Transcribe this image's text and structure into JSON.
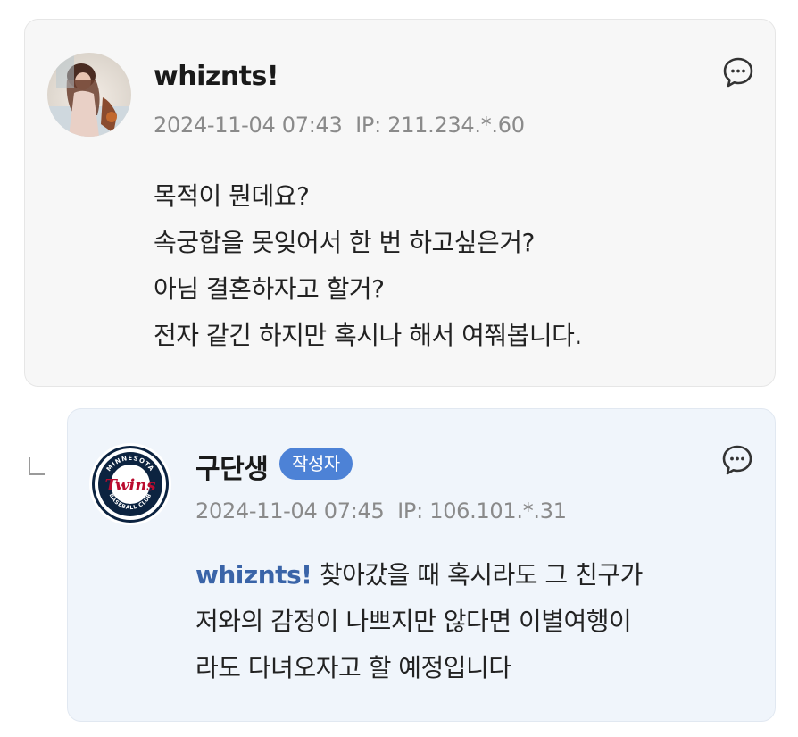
{
  "comments": [
    {
      "username": "whiznts!",
      "datetime": "2024-11-04 07:43",
      "ip": "IP: 211.234.*.60",
      "avatar_icon": "profile-photo",
      "reply_icon": "speech-bubble-icon",
      "lines": [
        "목적이 뭔데요?",
        "속궁합을 못잊어서 한 번 하고싶은거?",
        "아님 결혼하자고 할거?",
        "전자 같긴 하지만 혹시나 해서 여쭤봅니다."
      ]
    },
    {
      "username": "구단생",
      "badge": "작성자",
      "datetime": "2024-11-04 07:45",
      "ip": "IP: 106.101.*.31",
      "avatar_icon": "minnesota-twins-logo",
      "reply_icon": "speech-bubble-icon",
      "mention": "whiznts!",
      "lines": [
        "찾아갔을 때 혹시라도 그 친구가",
        "저와의 감정이 나쁘지만 않다면 이별여행이",
        "라도 다녀오자고 할 예정입니다"
      ],
      "logo_text": {
        "top": "MINNESOTA",
        "center": "Twins",
        "bottom": "BASEBALL CLUB"
      }
    }
  ],
  "colors": {
    "card_bg": "#f7f7f7",
    "reply_card_bg": "#f0f5fb",
    "badge_bg": "#4d82d6",
    "mention": "#3a64a8",
    "meta_text": "#8a8a8a"
  }
}
